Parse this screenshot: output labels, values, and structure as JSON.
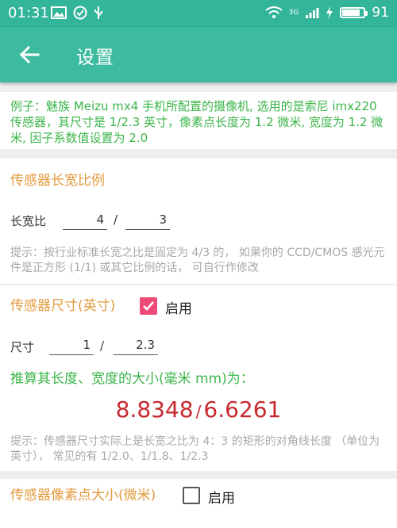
{
  "status": {
    "time": "01:31",
    "network_label": "3G",
    "battery_level": "91",
    "battery_fraction": 0.91
  },
  "appbar": {
    "title": "设置"
  },
  "example": {
    "text": "例子：魅族 Meizu mx4 手机所配置的摄像机, 选用的是索尼 imx220 传感器，其尺寸是 1/2.3 英寸，像素点长度为 1.2 微米, 宽度为 1.2 微米, 因子系数值设置为 2.0"
  },
  "aspect": {
    "heading": "传感器长宽比例",
    "label": "长宽比",
    "value_w": "4",
    "slash": "/",
    "value_h": "3",
    "hint": "提示：按行业标准长宽之比是固定为 4/3 的， 如果你的 CCD/CMOS 感光元件是正方形 (1/1) 或其它比例的话， 可自行作修改"
  },
  "size": {
    "heading": "传感器尺寸(英寸)",
    "enable_label": "启用",
    "enabled": true,
    "label": "尺寸",
    "value_num": "1",
    "slash": "/",
    "value_den": "2.3",
    "calc_label": "推算其长度、宽度的大小(毫米 mm)为：",
    "result_length": "8.8348",
    "result_slash": "/",
    "result_width": "6.6261",
    "hint": "提示：传感器尺寸实际上是长宽之比为 4：3 的矩形的对角线长度 （单位为英寸）， 常见的有 1/2.0、1/1.8、1/2.3"
  },
  "pixel": {
    "heading": "传感器像素点大小(微米)",
    "enable_label": "启用",
    "enabled": false
  }
}
